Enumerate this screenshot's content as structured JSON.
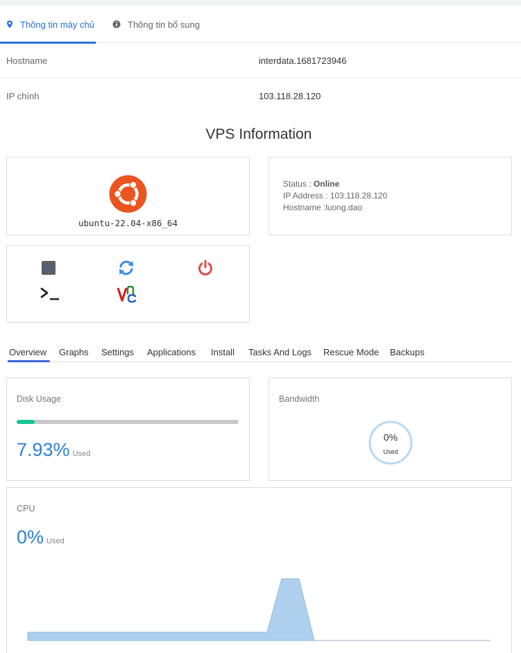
{
  "tabs": [
    {
      "label": "Thông tin máy chủ",
      "icon": "location-pin-icon",
      "active": true
    },
    {
      "label": "Thông tin bổ sung",
      "icon": "info-icon",
      "active": false
    }
  ],
  "info_rows": [
    {
      "key": "Hostname",
      "value": "interdata.1681723946"
    },
    {
      "key": "IP chính",
      "value": "103.118.28.120"
    }
  ],
  "title": "VPS Information",
  "os": {
    "name": "ubuntu-22.04-x86_64",
    "icon": "ubuntu-logo-icon"
  },
  "status_card": {
    "status_label": "Status :",
    "status_value": "Online",
    "ip_label": "IP Address :",
    "ip_value": "103.118.28.120",
    "hostname_label": "Hostname :",
    "hostname_value": "luong.dao"
  },
  "actions": [
    {
      "icon": "stop-icon",
      "color": "#5b5d6b"
    },
    {
      "icon": "refresh-icon",
      "color": "#3b8fe0"
    },
    {
      "icon": "power-icon",
      "color": "#e04b4b"
    },
    {
      "icon": "console-icon",
      "color": "#222222"
    },
    {
      "icon": "vnc-icon",
      "color": "#d62020"
    }
  ],
  "subtabs": [
    "Overview",
    "Graphs",
    "Settings",
    "Applications",
    "Install",
    "Tasks And Logs",
    "Rescue Mode",
    "Backups"
  ],
  "disk": {
    "label": "Disk Usage",
    "percent_text": "7.93%",
    "used_label": "Used",
    "fill_fraction": 0.08
  },
  "bandwidth": {
    "label": "Bandwidth",
    "percent_text": "0%",
    "used_label": "Used"
  },
  "cpu": {
    "label": "CPU",
    "percent_text": "0%",
    "used_label": "Used"
  },
  "colors": {
    "accent": "#2b6fd6",
    "progress": "#17c698",
    "chart_fill": "#aed0ee",
    "ring": "#b7d8f2"
  }
}
